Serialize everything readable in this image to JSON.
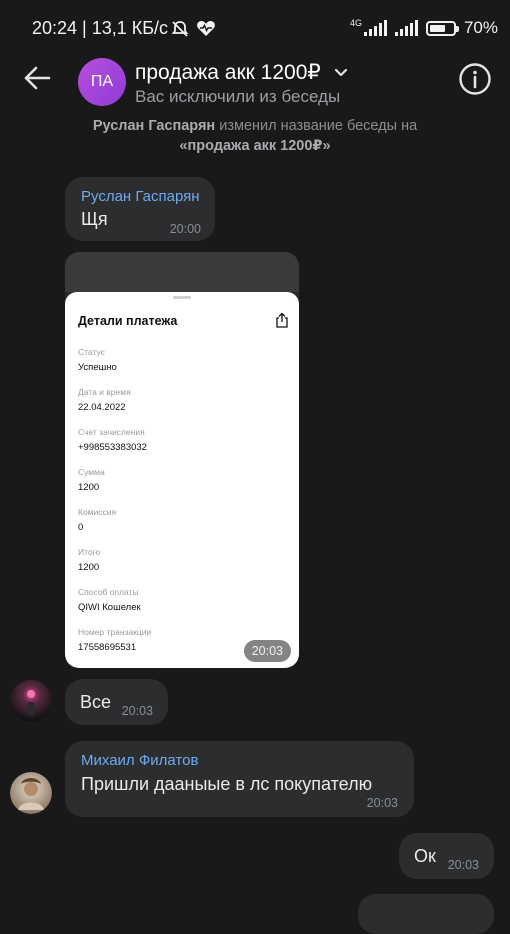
{
  "status_bar": {
    "left_text": "20:24 | 13,1 КБ/с",
    "network": "4G",
    "battery_percent_text": "70%",
    "battery_level": 0.7
  },
  "header": {
    "avatar_initials": "ПА",
    "title": "продажа акк 1200₽",
    "subtitle": "Вас исключили из беседы"
  },
  "service_message": {
    "actor": "Руслан Гаспарян",
    "text": " изменил название беседы на",
    "new_name": "«продажа акк 1200₽»"
  },
  "messages": [
    {
      "sender": "Руслан Гаспарян",
      "text": "Щя",
      "time": "20:00"
    },
    {
      "time": "20:03",
      "screenshot": {
        "title": "Детали платежа",
        "fields": [
          {
            "label": "Статус",
            "value": "Успешно"
          },
          {
            "label": "Дата и время",
            "value": "22.04.2022"
          },
          {
            "label": "Счет зачисления",
            "value": "+998553383032"
          },
          {
            "label": "Сумма",
            "value": "1200"
          },
          {
            "label": "Комиссия",
            "value": "0"
          },
          {
            "label": "Итого",
            "value": "1200"
          },
          {
            "label": "Способ оплаты",
            "value": "QIWI Кошелек"
          },
          {
            "label": "Номер транзакции",
            "value": "17558695531"
          }
        ]
      }
    },
    {
      "text": "Все",
      "time": "20:03"
    },
    {
      "sender": "Михаил Филатов",
      "text": "Пришли дааныые в лс покупателю",
      "time": "20:03"
    },
    {
      "text": "Ок",
      "time": "20:03"
    }
  ],
  "colors": {
    "background": "#19191a",
    "bubble": "#2c2d2f",
    "sender_name": "#71aaeb",
    "avatar_gradient": "#b84fdc"
  }
}
